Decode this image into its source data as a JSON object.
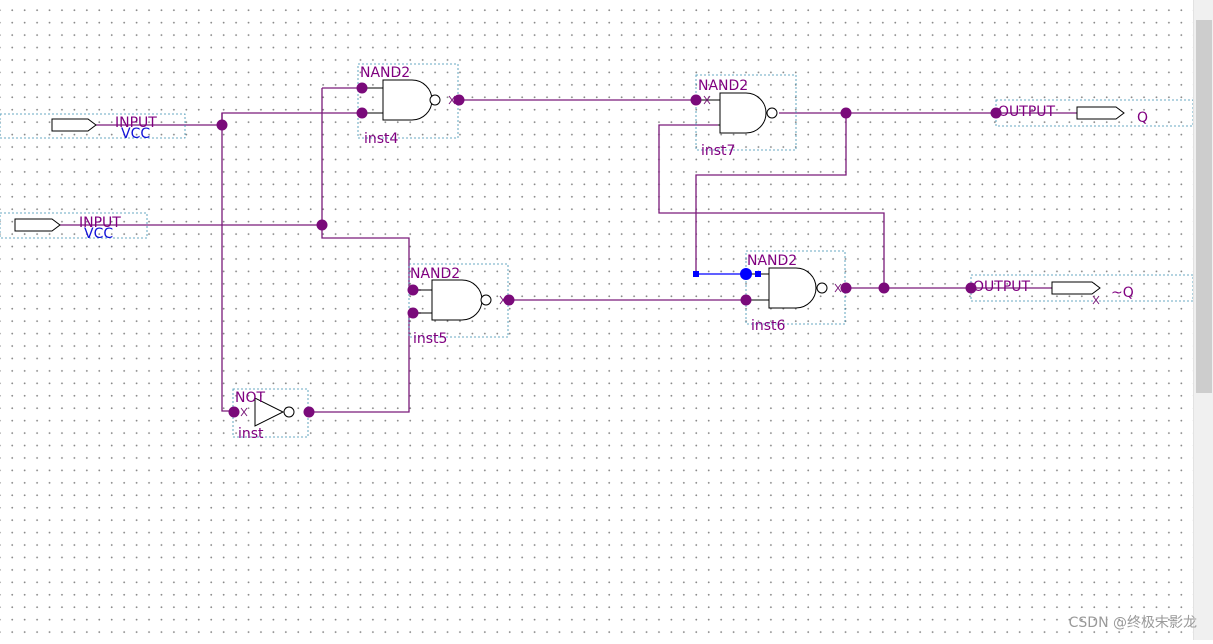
{
  "inputs": [
    {
      "type_label": "INPUT",
      "value_label": "VCC"
    },
    {
      "type_label": "INPUT",
      "value_label": "VCC"
    }
  ],
  "gates": {
    "inst4": {
      "type": "NAND2",
      "instance": "inst4"
    },
    "inst5": {
      "type": "NAND2",
      "instance": "inst5"
    },
    "inst": {
      "type": "NOT",
      "instance": "inst"
    },
    "inst7": {
      "type": "NAND2",
      "instance": "inst7"
    },
    "inst6": {
      "type": "NAND2",
      "instance": "inst6"
    }
  },
  "outputs": [
    {
      "type_label": "OUTPUT",
      "signal": "Q"
    },
    {
      "type_label": "OUTPUT",
      "signal": "~Q"
    }
  ],
  "watermark": "CSDN @终极末影龙",
  "colors": {
    "wire": "#7a1a7a",
    "label": "#800080",
    "vcc": "#1010d8",
    "selected": "#0000ff"
  }
}
